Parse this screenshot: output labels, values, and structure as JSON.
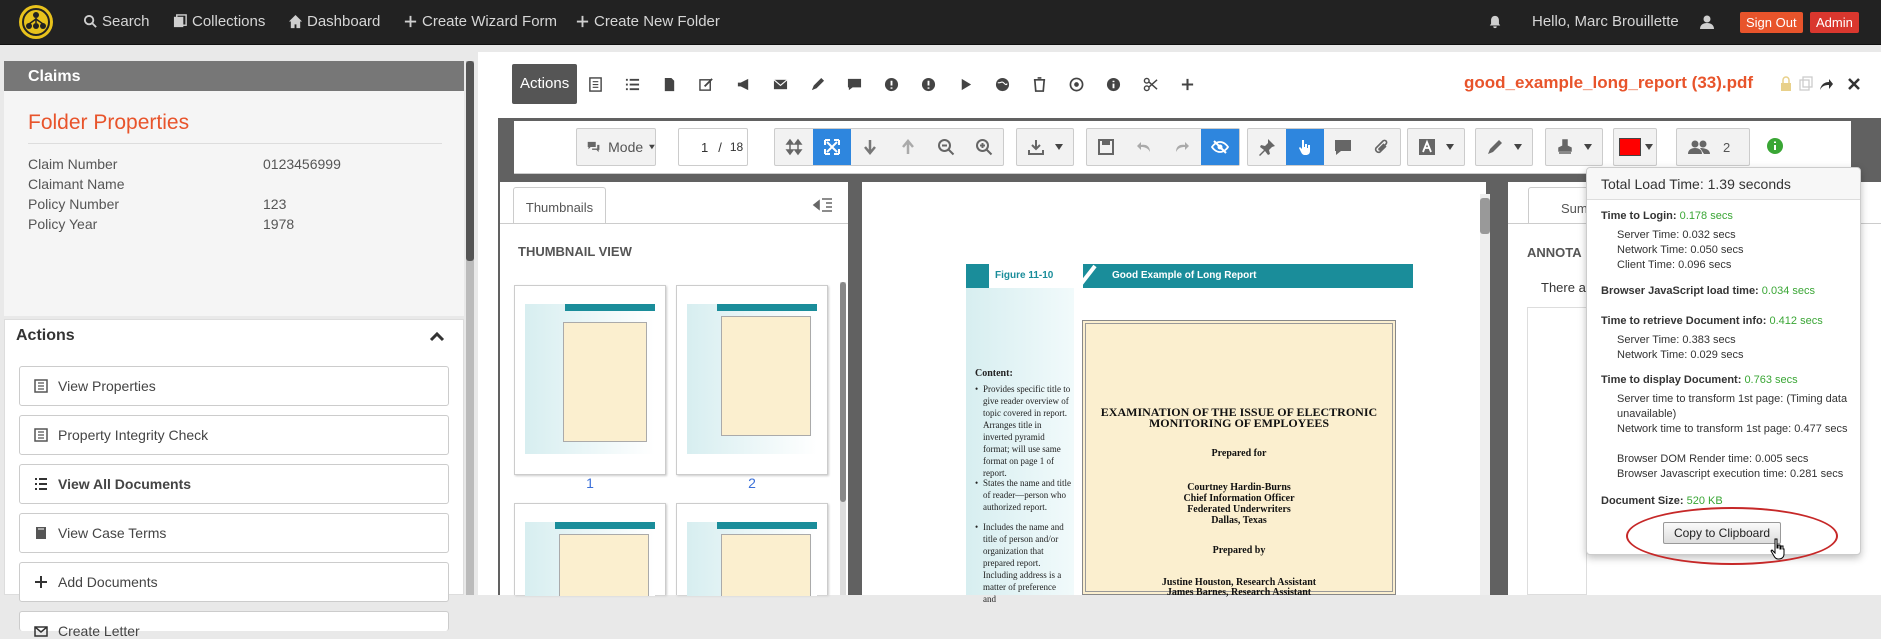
{
  "nav": {
    "search": "Search",
    "collections": "Collections",
    "dashboard": "Dashboard",
    "create_wizard": "Create Wizard Form",
    "create_folder": "Create New Folder",
    "greeting": "Hello, Marc Brouillette",
    "sign_out": "Sign Out",
    "admin": "Admin"
  },
  "left": {
    "claims_title": "Claims",
    "folder_title": "Folder Properties",
    "properties": [
      {
        "label": "Claim Number",
        "value": "0123456999"
      },
      {
        "label": "Claimant Name",
        "value": ""
      },
      {
        "label": "Policy Number",
        "value": "123"
      },
      {
        "label": "Policy Year",
        "value": "1978"
      }
    ],
    "actions_title": "Actions",
    "actions": [
      "View Properties",
      "Property Integrity Check",
      "View All Documents",
      "View Case Terms",
      "Add Documents",
      "Create Letter"
    ]
  },
  "main": {
    "actions_tab": "Actions",
    "doc_title": "good_example_long_report (33).pdf"
  },
  "viewer": {
    "mode_label": "Mode",
    "page_current": "1",
    "page_total": "18",
    "participants": "2",
    "color_accent": "#ff0000"
  },
  "thumbs": {
    "tab": "Thumbnails",
    "title": "THUMBNAIL VIEW",
    "page1": "1",
    "page2": "2"
  },
  "doc": {
    "fig_label": "Figure 11-10",
    "fig_title": "Good Example of Long Report",
    "content_hdr": "Content:",
    "bullets": [
      "Provides specific title to give reader overview of topic covered in report. Arranges title in inverted pyramid format; will use same format on page 1 of report.",
      "States the name and title of reader—person who authorized report.",
      "Includes the name and title of person and/or organization that prepared report. Including address is a matter of preference and"
    ],
    "report_title_1": "EXAMINATION OF THE ISSUE OF ELECTRONIC",
    "report_title_2": "MONITORING OF EMPLOYEES",
    "prepared_for": "Prepared for",
    "for_1": "Courtney Hardin-Burns",
    "for_2": "Chief Information Officer",
    "for_3": "Federated Underwriters",
    "for_4": "Dallas, Texas",
    "prepared_by": "Prepared by",
    "by_1": "Justine Houston, Research Assistant",
    "by_2": "James Barnes, Research Assistant"
  },
  "summary": {
    "tab": "Summar",
    "annot": "ANNOTA",
    "there": "There a"
  },
  "popup": {
    "header": "Total Load Time: 1.39 seconds",
    "login_label": "Time to Login:",
    "login_val": "0.178 secs",
    "login_server": "Server Time: 0.032 secs",
    "login_network": "Network Time: 0.050 secs",
    "login_client": "Client Time: 0.096 secs",
    "js_label": "Browser JavaScript load time:",
    "js_val": "0.034 secs",
    "docinfo_label": "Time to retrieve Document info:",
    "docinfo_val": "0.412 secs",
    "docinfo_server": "Server Time: 0.383 secs",
    "docinfo_network": "Network Time: 0.029 secs",
    "display_label": "Time to display Document:",
    "display_val": "0.763 secs",
    "display_1": "Server time to transform 1st page: (Timing data unavailable)",
    "display_2": "Network time to transform 1st page: 0.477 secs",
    "display_3": "Browser DOM Render time: 0.005 secs",
    "display_4": "Browser Javascript execution time: 0.281 secs",
    "size_label": "Document Size:",
    "size_val": "520 KB",
    "copy_button": "Copy to Clipboard"
  }
}
